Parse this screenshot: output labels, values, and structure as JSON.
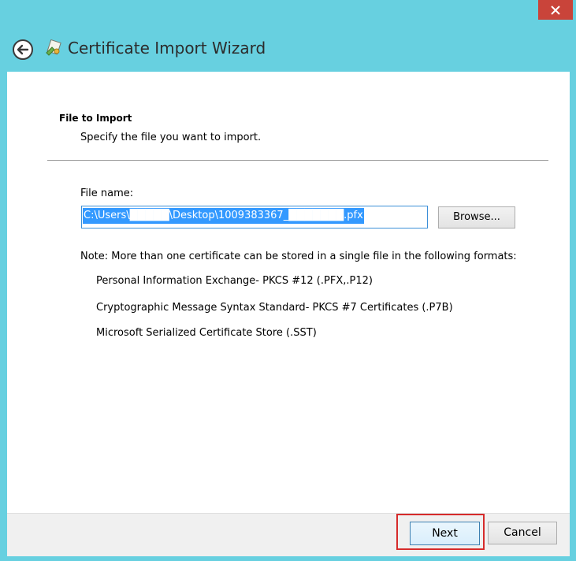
{
  "window": {
    "title": "Certificate Import Wizard",
    "accent_color": "#67d0e0",
    "close_color": "#c9443a"
  },
  "icons": {
    "close": "close-icon",
    "back": "back-arrow-icon",
    "wizard": "certificate-icon"
  },
  "section": {
    "title": "File to Import",
    "subtitle": "Specify the file you want to import."
  },
  "file": {
    "label": "File name:",
    "value": "C:\\Users\\█████\\Desktop\\1009383367_███████.pfx",
    "browse_label": "Browse..."
  },
  "note": "Note:  More than one certificate can be stored in a single file in the following formats:",
  "formats": [
    "Personal Information Exchange- PKCS #12 (.PFX,.P12)",
    "Cryptographic Message Syntax Standard- PKCS #7 Certificates (.P7B)",
    "Microsoft Serialized Certificate Store (.SST)"
  ],
  "footer": {
    "next_label": "Next",
    "cancel_label": "Cancel",
    "highlight_color": "#d62b2b"
  }
}
